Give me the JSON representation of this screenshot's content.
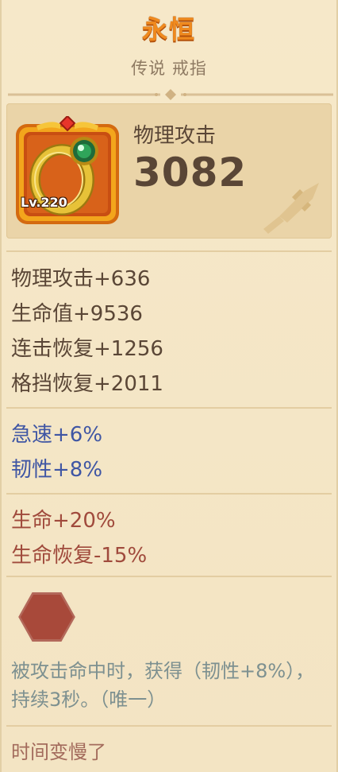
{
  "item": {
    "name": "永恒",
    "type": "传说 戒指",
    "level": "Lv.220"
  },
  "main_stat": {
    "label": "物理攻击",
    "value": "3082"
  },
  "base_stats": [
    "物理攻击+636",
    "生命值+9536",
    "连击恢复+1256",
    "格挡恢复+2011"
  ],
  "blue_stats": [
    "急速+6%",
    "韧性+8%"
  ],
  "red_stats": [
    "生命+20%",
    "生命恢复-15%"
  ],
  "skill": {
    "description": "被攻击命中时，获得（韧性+8%），持续3秒。（唯一）",
    "name": "时间变慢了",
    "icon": "hexagon-empty-slot-icon"
  },
  "colors": {
    "title": "#f08a1e",
    "blue_stat": "#3f56a4",
    "red_stat": "#a04a3c",
    "description": "#7d9090",
    "skill_name": "#a36b5c"
  }
}
